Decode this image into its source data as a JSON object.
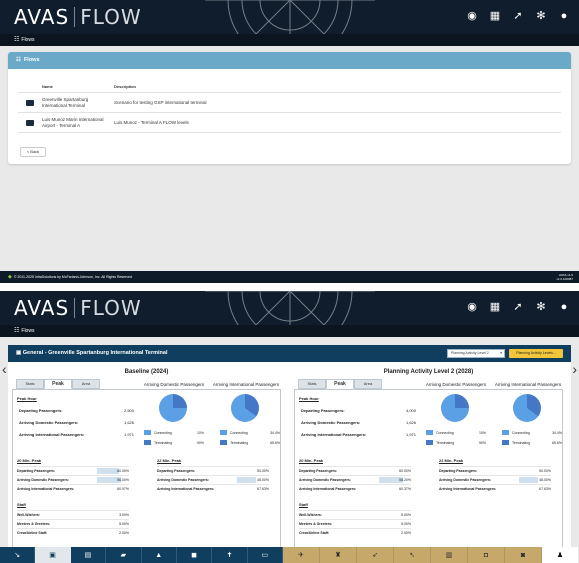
{
  "brand": {
    "logo_left": "AVAS",
    "logo_right": "FLOW"
  },
  "header_icons": [
    "settings-circle-icon",
    "grid-icon",
    "rocket-icon",
    "gear-icon",
    "user-icon"
  ],
  "screen1": {
    "breadcrumb": "Flows",
    "card_title": "Flows",
    "table_headers": {
      "name": "Name",
      "description": "Description"
    },
    "rows": [
      {
        "name": "Greenville Spartanburg International Terminal",
        "description": "Scenario for testing GSP international terminal"
      },
      {
        "name": "Luis Munoz Marin International Airport - Terminal A",
        "description": "Luis Munoz - Terminal A FLOW levels"
      }
    ],
    "back_label": "< Back",
    "footer_text": "© 2011-2025 InfraSolutions by McFarland-Johnson, Inc. All Rights Reserved",
    "version_line1": "AVAS v1.0",
    "version_line2": "v1.0.100087"
  },
  "screen2": {
    "breadcrumb": "Flows",
    "card_title": "General - Greenville Spartanburg International Terminal",
    "plan_select_value": "Planning Activity Level 2",
    "plan_button_label": "Planning Activity Levels...",
    "left": {
      "title": "Baseline (2024)",
      "tabs": [
        "Stats",
        "Peak",
        "Area"
      ],
      "active_tab": "Peak",
      "peak_hour_title": "Peak Hour",
      "departing_label": "Departing Passengers:",
      "departing_value": "2,500",
      "arr_dom_label": "Arriving Domestic Passengers:",
      "arr_dom_value": "1,626",
      "arr_int_label": "Arriving International Passengers:",
      "arr_int_value": "1,971",
      "pie1_title": "Arriving Domestic Passengers",
      "pie2_title": "Arriving International Passengers",
      "pie1_connecting": "10%",
      "pie1_terminating": "90%",
      "pie2_connecting": "34.4%",
      "pie2_terminating": "65.6%",
      "min20_title": "20 Min. Peak",
      "min22_title": "22 Min. Peak",
      "min20": [
        "60.00%",
        "56.00%",
        "60.97%"
      ],
      "min22": [
        "50.00%",
        "45.00%",
        "67.63%"
      ],
      "staff_title": "Staff",
      "staff": [
        {
          "label": "Well-Wishers:",
          "value": "3.00%"
        },
        {
          "label": "Meeters & Greeters:",
          "value": "5.00%"
        },
        {
          "label": "Crew/Airline Staff:",
          "value": "2.00%"
        }
      ]
    },
    "right": {
      "title": "Planning Activity Level 2 (2028)",
      "departing_value": "4,000",
      "arr_dom_value": "1,626",
      "arr_int_value": "1,971",
      "min20": [
        "60.00%",
        "58.20%",
        "60.37%"
      ],
      "min22": [
        "50.00%",
        "48.00%",
        "67.63%"
      ],
      "staff": [
        {
          "label": "Well-Wishers:",
          "value": "5.00%"
        },
        {
          "label": "Meeters & Greeters:",
          "value": "5.00%"
        },
        {
          "label": "Crew/Airline Staff:",
          "value": "2.00%"
        }
      ]
    },
    "legend_connecting": "Connecting",
    "legend_terminating": "Terminating"
  },
  "colors": {
    "header": "#101d2c",
    "accent_teal": "#6aa9c7",
    "navy": "#0f3e5e",
    "gold": "#c6a86b",
    "yellow_btn": "#f3c53a"
  }
}
